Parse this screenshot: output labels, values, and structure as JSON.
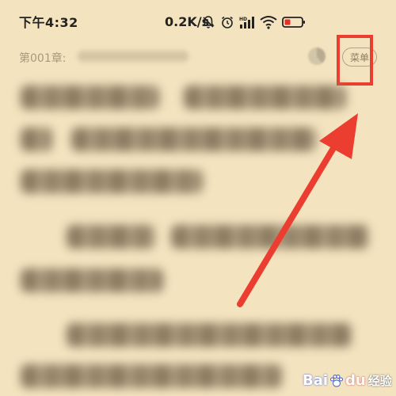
{
  "status_bar": {
    "time": "下午4:32",
    "network_speed": "0.2K/s",
    "icons": [
      "bell-off-icon",
      "alarm-icon",
      "signal-icon",
      "wifi-icon",
      "battery-icon"
    ]
  },
  "reader": {
    "chapter_label": "第001章:",
    "menu_label": "菜单"
  },
  "annotation": {
    "color": "#ec3e30"
  },
  "watermark": {
    "bai": "Bai",
    "du": "du",
    "jingyan": "经验"
  },
  "colors": {
    "page_background": "#f4e3bf",
    "accent_red": "#ec3e30"
  }
}
